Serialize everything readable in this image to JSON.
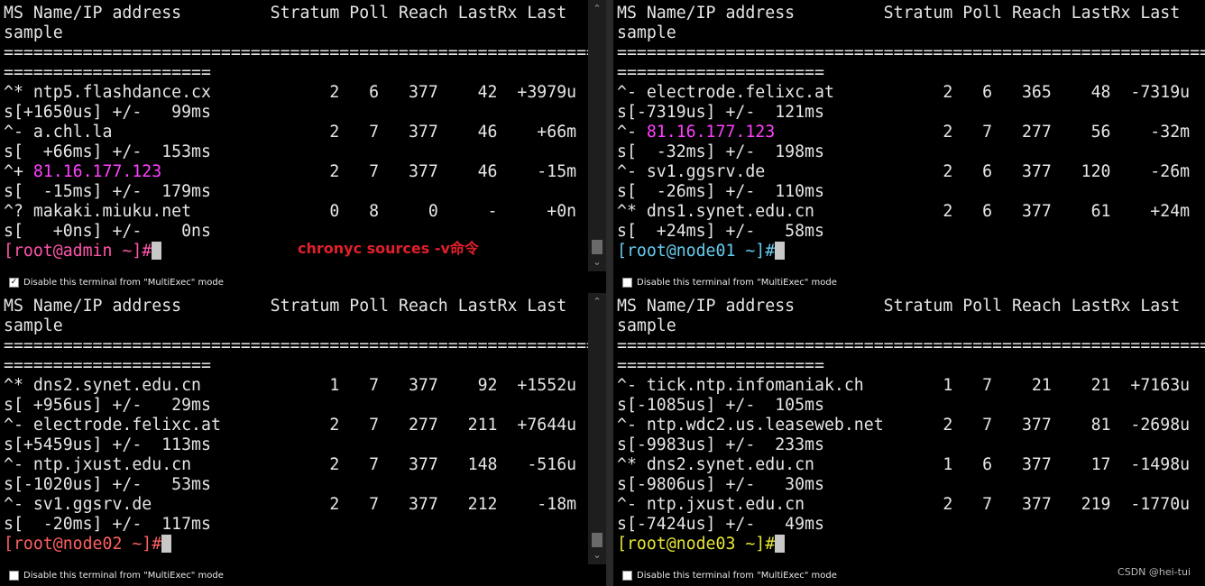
{
  "annotation": "chronyc  sources  -v命令",
  "watermark": "CSDN @hei-tui",
  "footer_label": "Disable this terminal from \"MultiExec\" mode",
  "panes": [
    {
      "footer_checked": true,
      "lines": [
        "MS Name/IP address         Stratum Poll Reach LastRx Last",
        "sample",
        "===============================================================",
        "=====================",
        "^* ntp5.flashdance.cx            2   6   377    42  +3979u",
        "s[+1650us] +/-   99ms",
        "^- a.chl.la                      2   7   377    46    +66m",
        "s[  +66ms] +/-  153ms",
        {
          "prefix": "^+ ",
          "highlight": "81.16.177.123",
          "suffix": "                 2   7   377    46    -15m"
        },
        "s[  -15ms] +/-  179ms",
        "^? makaki.miuku.net              0   8     0     -     +0n",
        "s[   +0ns] +/-    0ns"
      ],
      "prompt": "[root@admin ~]#",
      "prompt_color": "magenta"
    },
    {
      "footer_checked": false,
      "lines": [
        "MS Name/IP address         Stratum Poll Reach LastRx Last",
        "sample",
        "===============================================================",
        "=====================",
        "^- electrode.felixc.at           2   6   365    48  -7319u",
        "s[-7319us] +/-  121ms",
        {
          "prefix": "^- ",
          "highlight": "81.16.177.123",
          "suffix": "                 2   7   277    56    -32m"
        },
        "s[  -32ms] +/-  198ms",
        "^- sv1.ggsrv.de                  2   6   377   120    -26m",
        "s[  -26ms] +/-  110ms",
        "^* dns1.synet.edu.cn             2   6   377    61    +24m",
        "s[  +24ms] +/-   58ms"
      ],
      "prompt": "[root@node01 ~]#",
      "prompt_color": "cyan"
    },
    {
      "footer_checked": false,
      "lines": [
        "MS Name/IP address         Stratum Poll Reach LastRx Last",
        "sample",
        "===============================================================",
        "=====================",
        "^* dns2.synet.edu.cn             1   7   377    92  +1552u",
        "s[ +956us] +/-   29ms",
        "^- electrode.felixc.at           2   7   277   211  +7644u",
        "s[+5459us] +/-  113ms",
        "^- ntp.jxust.edu.cn              2   7   377   148   -516u",
        "s[-1020us] +/-   53ms",
        "^- sv1.ggsrv.de                  2   7   377   212    -18m",
        "s[  -20ms] +/-  117ms"
      ],
      "prompt": "[root@node02 ~]#",
      "prompt_color": "red"
    },
    {
      "footer_checked": false,
      "lines": [
        "MS Name/IP address         Stratum Poll Reach LastRx Last",
        "sample",
        "===============================================================",
        "=====================",
        "^- tick.ntp.infomaniak.ch        1   7    21    21  +7163u",
        "s[-1085us] +/-  105ms",
        "^- ntp.wdc2.us.leaseweb.net      2   7   377    81  -2698u",
        "s[-9983us] +/-  233ms",
        "^* dns2.synet.edu.cn             1   6   377    17  -1498u",
        "s[-9806us] +/-   30ms",
        "^- ntp.jxust.edu.cn              2   7   377   219  -1770u",
        "s[-7424us] +/-   49ms"
      ],
      "prompt": "[root@node03 ~]#",
      "prompt_color": "yellow"
    }
  ]
}
